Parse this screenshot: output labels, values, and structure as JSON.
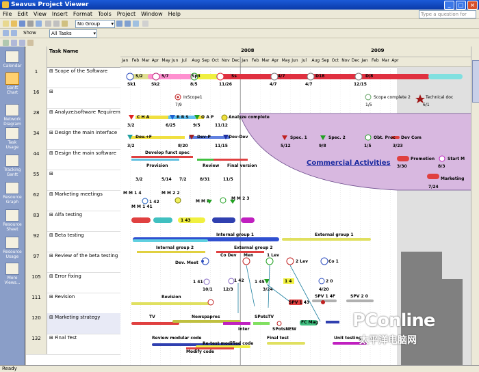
{
  "window": {
    "title": "Seavus Project Viewer"
  },
  "menu": [
    "File",
    "Edit",
    "View",
    "Insert",
    "Format",
    "Tools",
    "Project",
    "Window",
    "Help"
  ],
  "help_placeholder": "Type a question for help",
  "toolbar": {
    "group_value": "No Group",
    "show_label": "Show",
    "filter_value": "All Tasks"
  },
  "viewbar": [
    "Calendar",
    "Gantt Chart",
    "Network Diagram",
    "Task Usage",
    "Tracking Gantt",
    "Resource Graph",
    "Resource Sheet",
    "Resource Usage",
    "More Views..."
  ],
  "grid": {
    "header": "Task Name",
    "rows": [
      {
        "id": "1",
        "name": "Scope of the Software"
      },
      {
        "id": "16",
        "name": ""
      },
      {
        "id": "28",
        "name": "Analyze/software Requirement"
      },
      {
        "id": "34",
        "name": "Design the main interface"
      },
      {
        "id": "44",
        "name": "Design the main software"
      },
      {
        "id": "55",
        "name": ""
      },
      {
        "id": "62",
        "name": "Marketing meetings"
      },
      {
        "id": "83",
        "name": "Alfa testing"
      },
      {
        "id": "92",
        "name": "Beta testing"
      },
      {
        "id": "97",
        "name": "Review of the beta testing"
      },
      {
        "id": "105",
        "name": "Error fixing"
      },
      {
        "id": "111",
        "name": "Revision"
      },
      {
        "id": "120",
        "name": "Marketing strategy"
      },
      {
        "id": "132",
        "name": "Final Test"
      }
    ]
  },
  "timescale": {
    "years": [
      "2008",
      "2009"
    ],
    "months": [
      "Jan",
      "Feb",
      "Mar",
      "Apr",
      "May",
      "Jun",
      "Jul",
      "Aug",
      "Sep",
      "Oct",
      "Nov",
      "Dec",
      "Jan",
      "Feb",
      "Mar",
      "Apr",
      "May",
      "Jun",
      "Jul",
      "Aug",
      "Sep",
      "Oct",
      "Nov",
      "Dec",
      "Jan",
      "Feb",
      "Mar",
      "Apr"
    ]
  },
  "gantt": {
    "labels": {
      "r1_top": [
        "S/2",
        "5/7",
        "Sp3",
        "Ss",
        "4/7",
        "D18",
        "D/8"
      ],
      "r1_bot": [
        "Sk1",
        "Sk2",
        "8/5",
        "11/26",
        "4/7",
        "4/7",
        "12/15"
      ],
      "r16": [
        "InScope1",
        "7/9",
        "Scope complete 2",
        "1/5",
        "Technical doc",
        "6/1"
      ],
      "r28": [
        "C H A",
        "R R S",
        "O A P",
        "Analyze complete",
        "3/2",
        "6/25",
        "9/5",
        "11/12"
      ],
      "r34": [
        "Dev.+F",
        "Dev-P",
        "Dev-Dev",
        "3/2",
        "8/20",
        "11/15",
        "Spec. 1",
        "5/12",
        "Spec. 2",
        "9/8",
        "Obt. Proc",
        "1/5",
        "Dev Com",
        "3/23"
      ],
      "r44": [
        "Develop funct spec",
        "Provision",
        "Review",
        "Final version",
        "Promotion",
        "3/30",
        "Start M",
        "8/3"
      ],
      "r55": [
        "3/2",
        "5/14",
        "7/2",
        "8/31",
        "11/5",
        "Marketing",
        "7/24"
      ],
      "r62": [
        "M M 1 4",
        "M M 2 2",
        "M M 2 3",
        "M M F",
        "M M 1 41",
        "1 42"
      ],
      "r83": [
        "1 43"
      ],
      "r92": [
        "Internal group 1",
        "External group 1",
        "Internal group 2",
        "External group 2"
      ],
      "r97": [
        "Co Dev",
        "Men",
        "1 Lev",
        "2 Lev",
        "Co 1",
        "Dev. Meet"
      ],
      "r105": [
        "1 41",
        "1 42",
        "1 45",
        "1 4",
        "2 0",
        "10/1",
        "12/3",
        "3/24",
        "4/20"
      ],
      "r111": [
        "Revision",
        "SPV 1 4F",
        "SPV 2 0",
        "SPV 1 43"
      ],
      "r120": [
        "TV",
        "Newspapres",
        "SPotsTV",
        "FC Mag",
        "Inter",
        "SPotsNEW"
      ],
      "r132": [
        "Review modular code",
        "Re-test modified code",
        "Final test",
        "Unit testing",
        "Modify code"
      ]
    },
    "commercial_activities": "Commercial Activities"
  },
  "status": "Ready",
  "watermark": {
    "line1": "PConline",
    "line2": "太平洋电脑网"
  },
  "colors": {
    "titlebar": "#0a3aa8",
    "view_bar": "#8a9ec8",
    "commercial": "#d8b8e0"
  }
}
